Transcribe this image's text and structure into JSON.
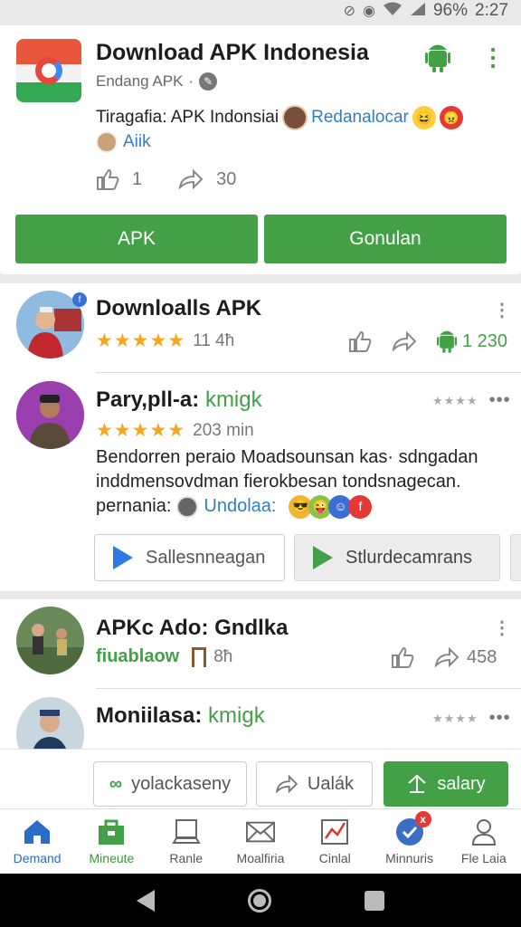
{
  "status_bar": {
    "battery": "96%",
    "time": "2:27"
  },
  "app": {
    "title": "Download APK Indonesia",
    "subtitle": "Endang APK",
    "subtitle_sep": "·",
    "desc_prefix": "Tiragafia: APK Indonsiai",
    "desc_link": "Redanalocar",
    "second_link": "Aiik",
    "likes": "1",
    "shares": "30",
    "btn_primary": "APK",
    "btn_secondary": "Gonulan"
  },
  "post1": {
    "name": "Downloalls APK",
    "stars": "★★★★★",
    "meta": "11 4ħ",
    "count": "1 230"
  },
  "post2": {
    "name_prefix": "Pary,pll-a:",
    "name_tag": "kmigk",
    "small_stars": "★★★★",
    "dots": "•••",
    "stars": "★★★★★",
    "meta": "203 min",
    "body_line1": "Bendorren peraio Moadsounsan kas· sdngadan",
    "body_line2": "inddmensovdman fierokbesan tondsnagecan.",
    "body_prefix": "pernania:",
    "body_link": "Undolaa:",
    "btn1": "Sallesnneagan",
    "btn2": "Stlurdecamrans"
  },
  "post3": {
    "name": "APKc Ado: Gndlka",
    "tag": "fiuablaow",
    "meta": "8ħ",
    "count": "458"
  },
  "post4": {
    "name_prefix": "Moniilasa:",
    "name_tag": "kmigk",
    "small_stars": "★★★★",
    "dots": "•••"
  },
  "actions": {
    "btn1": "yolackaseny",
    "btn2": "Ualák",
    "btn3": "salary"
  },
  "nav": [
    {
      "label": "Demand",
      "icon": "home-icon"
    },
    {
      "label": "Mineute",
      "icon": "shop-icon"
    },
    {
      "label": "Ranle",
      "icon": "monitor-icon"
    },
    {
      "label": "Moalfiria",
      "icon": "mail-icon"
    },
    {
      "label": "Cinlal",
      "icon": "chart-icon"
    },
    {
      "label": "Minnuris",
      "icon": "check-badge-icon",
      "badge": "x"
    },
    {
      "label": "Fle Laia",
      "icon": "person-icon"
    }
  ],
  "colors": {
    "accent_green": "#43a047",
    "link_blue": "#2f7fc1",
    "star_orange": "#f4a61f"
  }
}
